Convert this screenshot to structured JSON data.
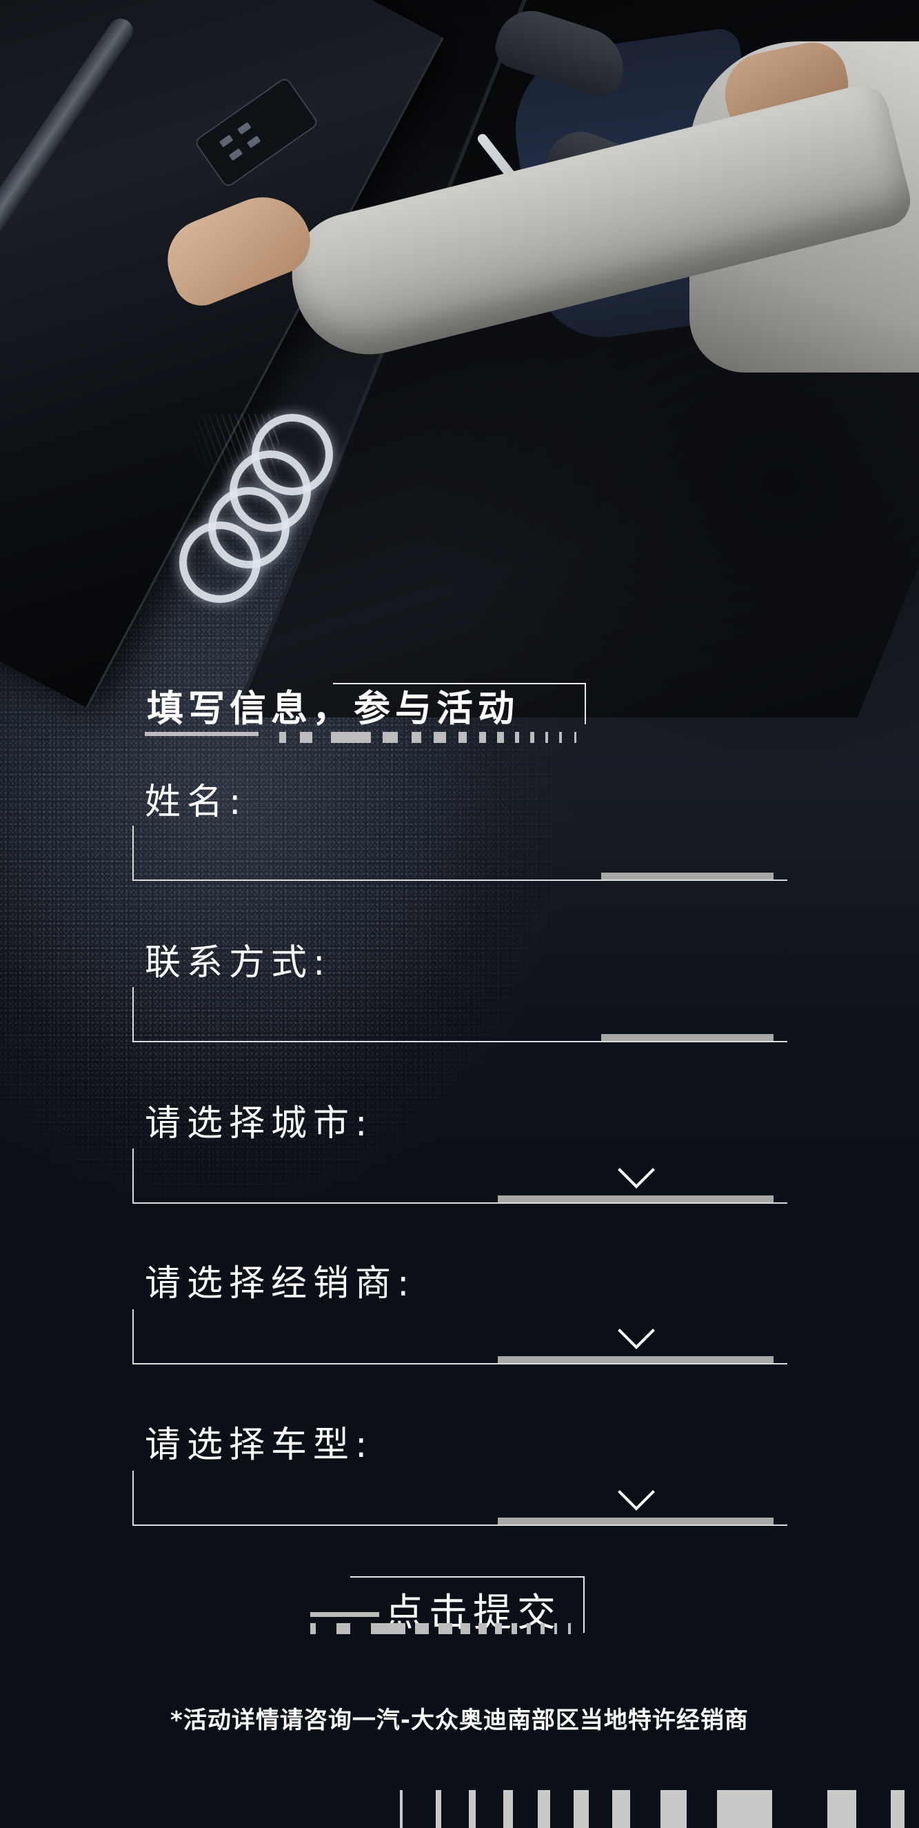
{
  "heading": {
    "title": "填写信息，参与活动"
  },
  "form": {
    "name_label": "姓名:",
    "name_value": "",
    "contact_label": "联系方式:",
    "contact_value": "",
    "city_label": "请选择城市:",
    "city_value": "",
    "dealer_label": "请选择经销商:",
    "dealer_value": "",
    "model_label": "请选择车型:",
    "model_value": ""
  },
  "submit": {
    "label": "点击提交"
  },
  "footer": {
    "disclaimer": "*活动详情请咨询一汽-大众奥迪南部区当地特许经销商"
  },
  "colors": {
    "background": "#0b0f17",
    "text": "#ffffff",
    "accent_gray": "#a8a8a8",
    "line": "#dcdcdc"
  },
  "icons": {
    "dropdown": "chevron-down-icon",
    "logo": "audi-rings-logo"
  }
}
